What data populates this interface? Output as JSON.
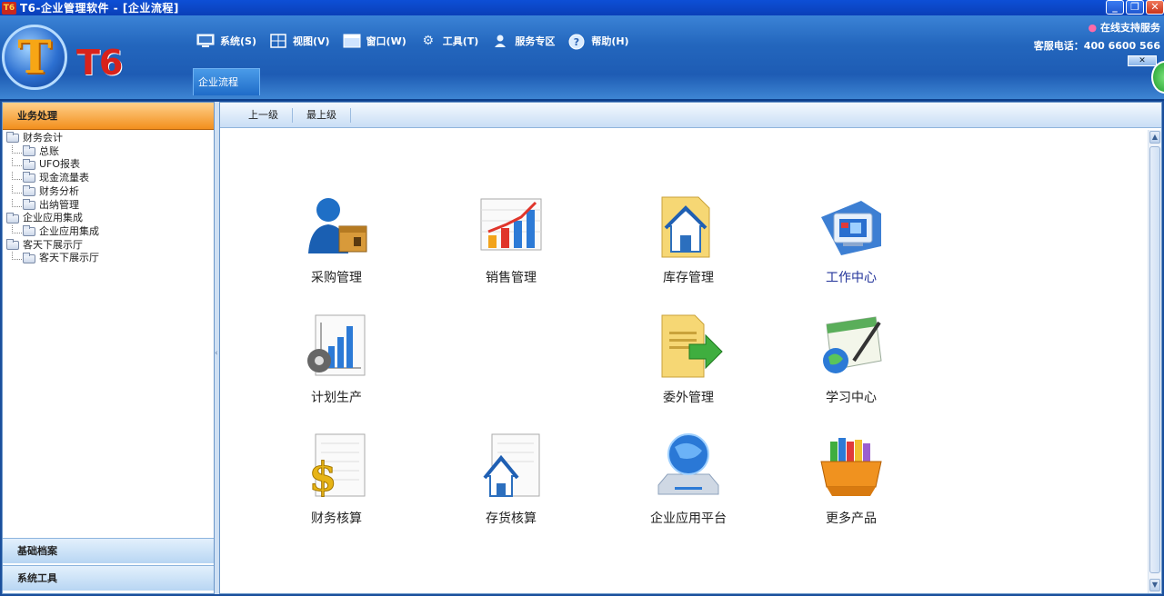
{
  "window": {
    "app_icon": "T6",
    "title": "T6-企业管理软件 - [企业流程]",
    "minimize": "_",
    "restore": "❐",
    "close": "✕"
  },
  "header": {
    "logo_letter": "T",
    "logo_text": "T6",
    "support_link": "在线支持服务",
    "hotline": "客服电话：400 6600 566",
    "close_glyph": "✕"
  },
  "menu": [
    {
      "label": "系统(S)",
      "icon": "monitor-icon"
    },
    {
      "label": "视图(V)",
      "icon": "grid-icon"
    },
    {
      "label": "窗口(W)",
      "icon": "window-icon"
    },
    {
      "label": "工具(T)",
      "icon": "gear-icon"
    },
    {
      "label": "服务专区",
      "icon": "person-icon"
    },
    {
      "label": "帮助(H)",
      "icon": "help-icon"
    }
  ],
  "tabs": [
    {
      "label": "企业流程"
    }
  ],
  "left_panel": {
    "header": "业务处理",
    "tree": [
      {
        "label": "财务会计",
        "level": 0
      },
      {
        "label": "总账",
        "level": 1
      },
      {
        "label": "UFO报表",
        "level": 1
      },
      {
        "label": "现金流量表",
        "level": 1
      },
      {
        "label": "财务分析",
        "level": 1
      },
      {
        "label": "出纳管理",
        "level": 1
      },
      {
        "label": "企业应用集成",
        "level": 0
      },
      {
        "label": "企业应用集成",
        "level": 1
      },
      {
        "label": "客天下展示厅",
        "level": 0
      },
      {
        "label": "客天下展示厅",
        "level": 1
      }
    ],
    "sections": [
      "基础档案",
      "系统工具"
    ]
  },
  "main": {
    "nav": [
      "上一级",
      "最上级"
    ],
    "tiles": [
      {
        "label": "采购管理",
        "icon": "purchase-icon"
      },
      {
        "label": "销售管理",
        "icon": "sales-chart-icon"
      },
      {
        "label": "库存管理",
        "icon": "warehouse-icon"
      },
      {
        "label": "工作中心",
        "icon": "work-center-icon",
        "highlight": true
      },
      {
        "label": "计划生产",
        "icon": "production-plan-icon"
      },
      {
        "label": "委外管理",
        "icon": "outsourcing-icon"
      },
      {
        "label": "学习中心",
        "icon": "learning-icon"
      },
      {
        "label": "财务核算",
        "icon": "finance-icon"
      },
      {
        "label": "存货核算",
        "icon": "inventory-accounting-icon"
      },
      {
        "label": "企业应用平台",
        "icon": "platform-icon"
      },
      {
        "label": "更多产品",
        "icon": "more-products-icon"
      }
    ]
  },
  "colors": {
    "title_bar": "#0d4fd6",
    "header_blue": "#2366bd",
    "panel_header_orange": "#f28f1d",
    "highlight_label": "#22339a"
  }
}
